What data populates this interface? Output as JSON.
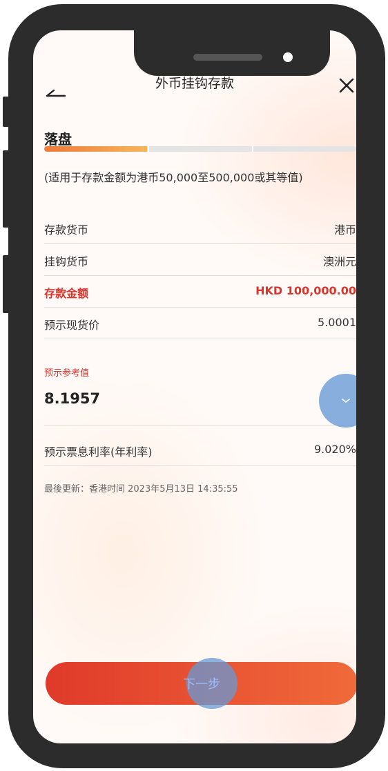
{
  "header": {
    "title": "外币挂钩存款"
  },
  "step": {
    "label": "落盘",
    "progress": 0.33
  },
  "note": "(适用于存款金额为港币50,000至500,000或其等值)",
  "details": [
    {
      "label": "存款货币",
      "value": "港币"
    },
    {
      "label": "挂钩货币",
      "value": "澳洲元"
    },
    {
      "label": "存款金额",
      "value": "HKD 100,000.00",
      "highlight": true
    },
    {
      "label": "预示现货价",
      "value": "5.0001"
    }
  ],
  "reference": {
    "label": "预示参考值",
    "value": "8.1957"
  },
  "coupon": {
    "label": "预示票息利率(年利率)",
    "value": "9.020%"
  },
  "last_updated": "最後更新：香港时间 2023年5月13日 14:35:55",
  "actions": {
    "next_label": "下一步"
  },
  "colors": {
    "accent": "#d9352b",
    "button_start": "#e03a2a",
    "button_end": "#f06a3a",
    "progress": "#f07a3a",
    "tap_marker": "#6699d6"
  },
  "icons": {
    "back": "back-arrow-icon",
    "close": "close-icon",
    "dropdown": "chevron-down-icon"
  }
}
